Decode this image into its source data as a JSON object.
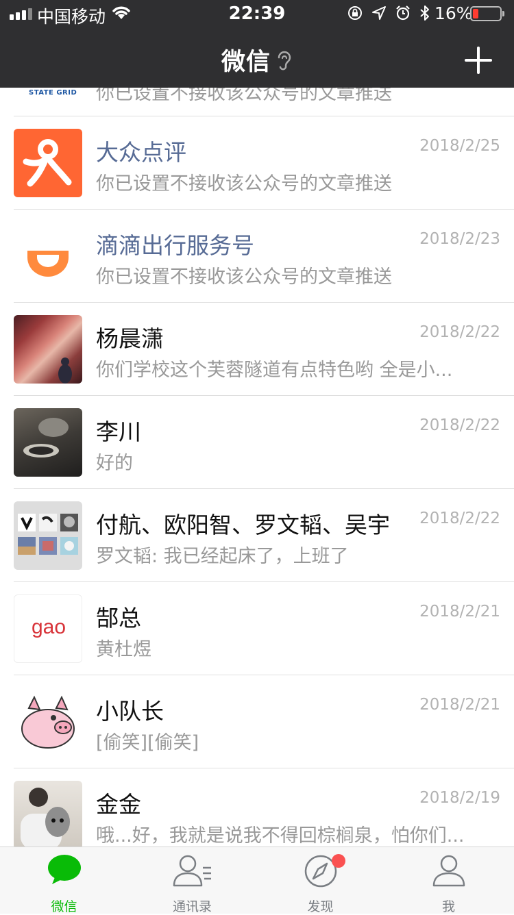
{
  "status_bar": {
    "carrier": "中国移动",
    "time": "22:39",
    "battery_percent": "16%",
    "battery_level": 0.16,
    "battery_color": "#ff3b30"
  },
  "nav": {
    "title": "微信",
    "ear_icon": "ear-icon",
    "add_icon": "plus-icon"
  },
  "partial_row": {
    "logo_text": "STATE GRID",
    "message": "你已设置不接收该公众号的文章推送"
  },
  "chats": [
    {
      "name": "大众点评",
      "message": "你已设置不接收该公众号的文章推送",
      "date": "2018/2/25",
      "official": true,
      "avatar": "dianping-logo"
    },
    {
      "name": "滴滴出行服务号",
      "message": "你已设置不接收该公众号的文章推送",
      "date": "2018/2/23",
      "official": true,
      "avatar": "didi-logo"
    },
    {
      "name": "杨晨潇",
      "message": "你们学校这个芙蓉隧道有点特色哟 全是小...",
      "date": "2018/2/22",
      "official": false,
      "avatar": "photo-canyon"
    },
    {
      "name": "李川",
      "message": "好的",
      "date": "2018/2/22",
      "official": false,
      "avatar": "photo-teapot"
    },
    {
      "name": "付航、欧阳智、罗文韬、吴宇",
      "message": "罗文韬: 我已经起床了，上班了",
      "date": "2018/2/22",
      "official": false,
      "avatar": "group-grid"
    },
    {
      "name": "郜总",
      "message": "黄杜煜",
      "date": "2018/2/21",
      "official": false,
      "avatar": "gao-logo",
      "avatar_text": "gao"
    },
    {
      "name": "小队长",
      "message": "[偷笑][偷笑]",
      "date": "2018/2/21",
      "official": false,
      "avatar": "cartoon-pig"
    },
    {
      "name": "金金",
      "message": "哦...好，我就是说我不得回棕榈泉，怕你们...",
      "date": "2018/2/19",
      "official": false,
      "avatar": "photo-dog"
    }
  ],
  "tabs": [
    {
      "label": "微信",
      "icon": "chat-bubble-icon",
      "active": true
    },
    {
      "label": "通讯录",
      "icon": "contacts-icon",
      "active": false
    },
    {
      "label": "发现",
      "icon": "compass-icon",
      "active": false,
      "badge": true
    },
    {
      "label": "我",
      "icon": "person-icon",
      "active": false
    }
  ],
  "colors": {
    "accent": "#09bb07",
    "official_name": "#576b95",
    "header": "#2f2f31",
    "badge": "#fa5151"
  }
}
